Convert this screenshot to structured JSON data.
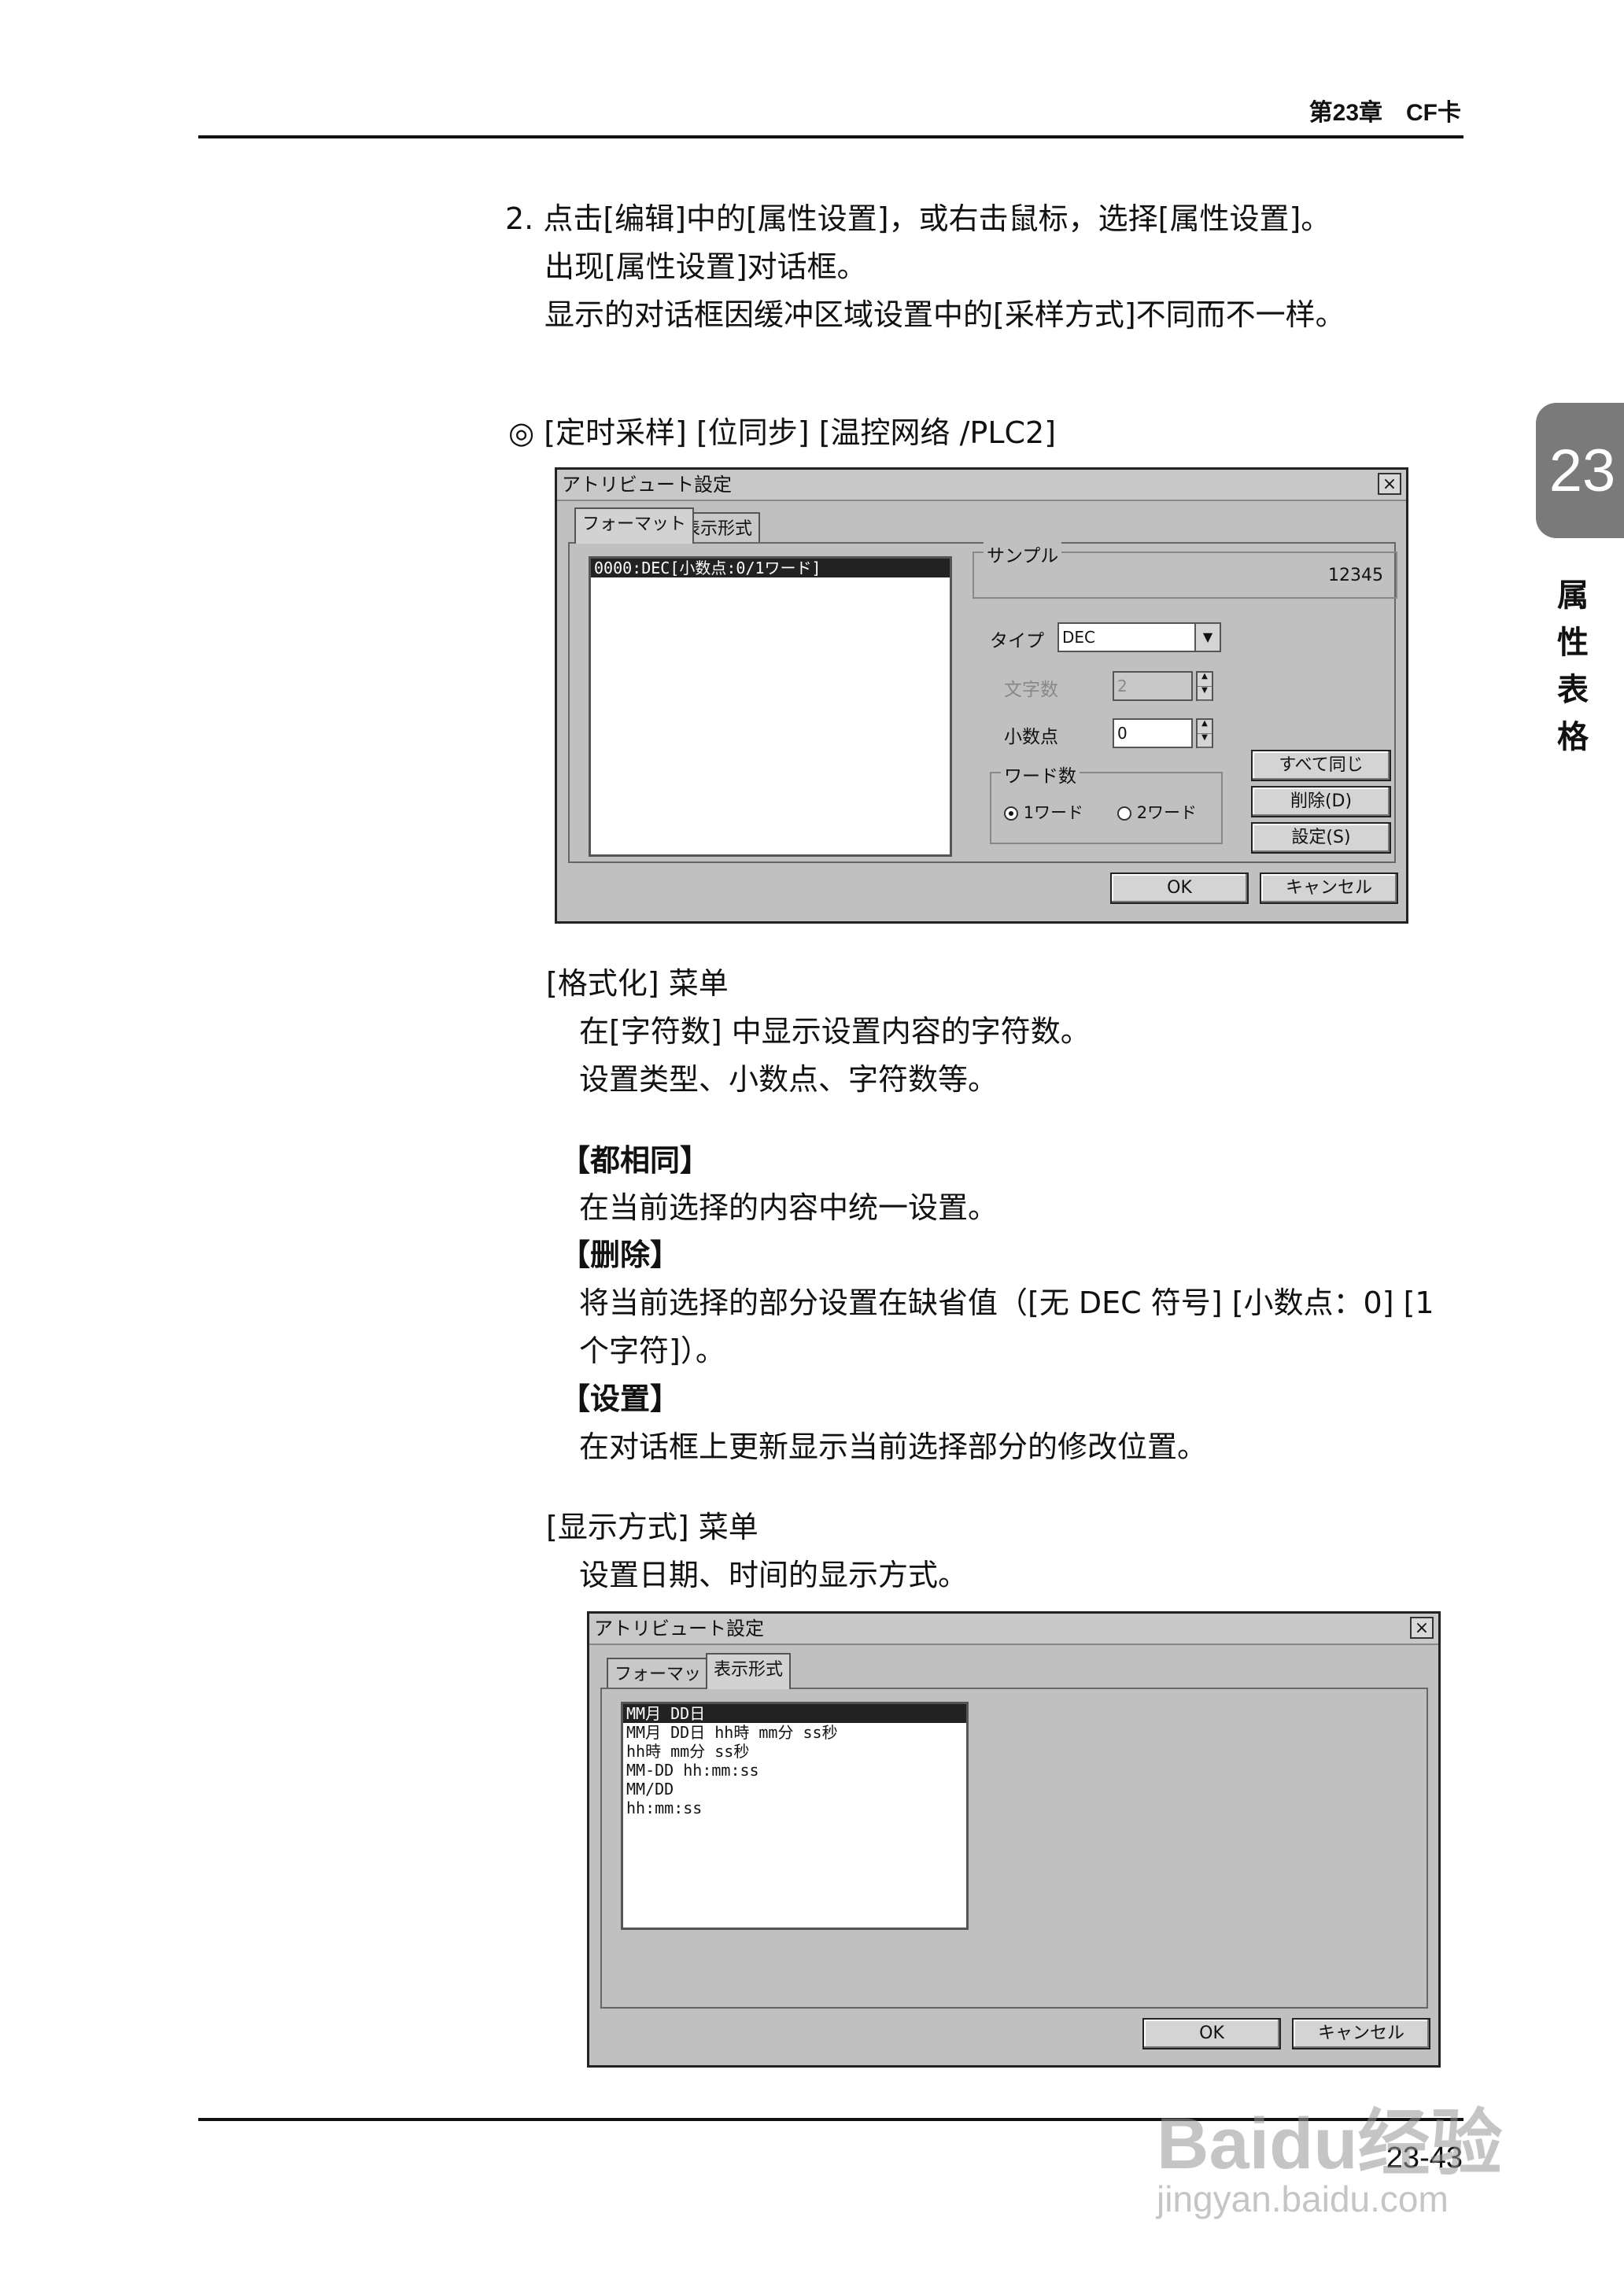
{
  "header": {
    "chapter": "第23章　CF卡"
  },
  "side_tab": {
    "number": "23",
    "title_chars": [
      "属",
      "性",
      "表",
      "格"
    ]
  },
  "step": {
    "line1": "2. 点击[编辑]中的[属性设置]，或右击鼠标，选择[属性设置]。",
    "line2": "出现[属性设置]对话框。",
    "line3": "显示的对话框因缓冲区域设置中的[采样方式]不同而不一样。"
  },
  "section_heading": "◎ [定时采样] [位同步] [温控网络 /PLC2]",
  "dialog1": {
    "title": "アトリビュート設定",
    "close": "×",
    "tabs": [
      "フォーマット",
      "表示形式"
    ],
    "list_items": [
      "0000:DEC[小数点:0/1ワード]"
    ],
    "sample_group": "サンプル",
    "sample_value": "12345",
    "type_label": "タイプ",
    "type_value": "DEC",
    "chars_label": "文字数",
    "chars_value": "2",
    "decimal_label": "小数点",
    "decimal_value": "0",
    "word_group": "ワード数",
    "radio_1word": "1ワード",
    "radio_2word": "2ワード",
    "btn_all_same": "すべて同じ",
    "btn_delete": "削除(D)",
    "btn_set": "設定(S)",
    "btn_ok": "OK",
    "btn_cancel": "キャンセル"
  },
  "format_menu": {
    "title": "[格式化] 菜单",
    "desc1": "在[字符数] 中显示设置内容的字符数。",
    "desc2": "设置类型、小数点、字符数等。",
    "all_same_title": "【都相同】",
    "all_same_desc": "在当前选择的内容中统一设置。",
    "delete_title": "【删除】",
    "delete_desc1": "将当前选择的部分设置在缺省值（[无 DEC 符号] [小数点：0] [1",
    "delete_desc2": "个字符]）。",
    "set_title": "【设置】",
    "set_desc": "在对话框上更新显示当前选择部分的修改位置。"
  },
  "display_menu": {
    "title": "[显示方式] 菜单",
    "desc": "设置日期、时间的显示方式。"
  },
  "dialog2": {
    "title": "アトリビュート設定",
    "close": "×",
    "tabs": [
      "フォーマット",
      "表示形式"
    ],
    "list_items": [
      "MM月 DD日",
      "MM月 DD日 hh時 mm分 ss秒",
      "hh時 mm分 ss秒",
      "MM-DD hh:mm:ss",
      "MM/DD",
      "hh:mm:ss"
    ],
    "btn_ok": "OK",
    "btn_cancel": "キャンセル"
  },
  "footer": {
    "page_number": "23-43"
  },
  "watermark": {
    "brand": "Baidu经验",
    "url": "jingyan.baidu.com"
  }
}
